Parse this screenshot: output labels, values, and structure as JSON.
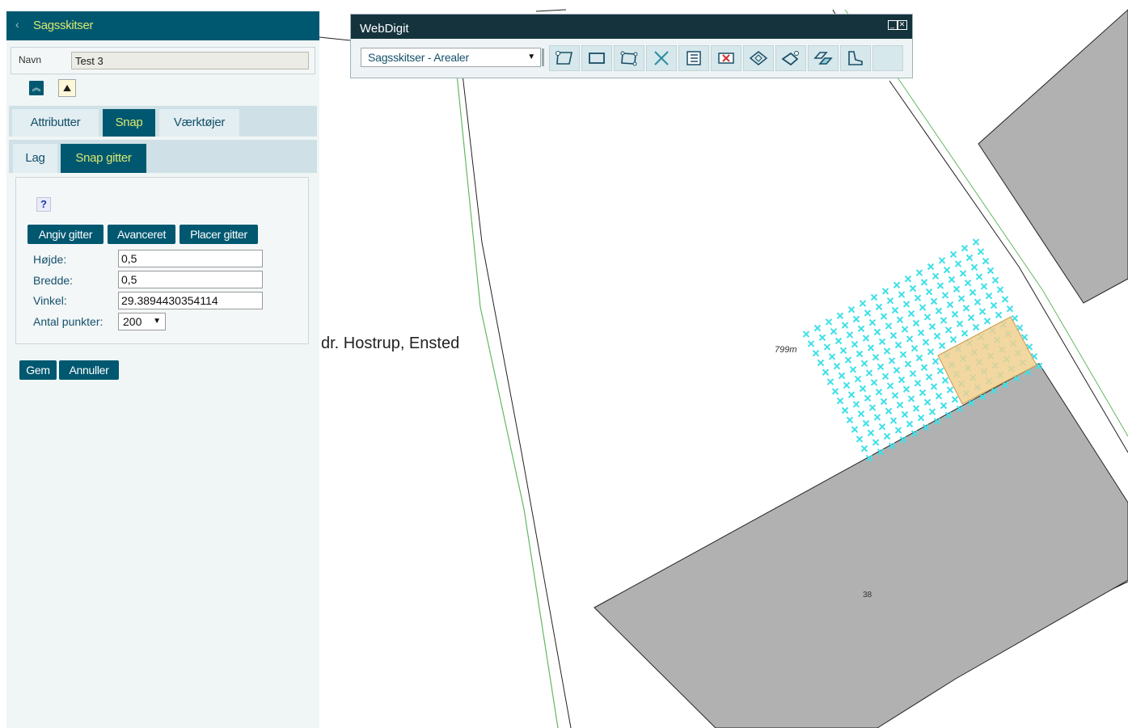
{
  "panel": {
    "title": "Sagsskitser",
    "name_label": "Navn",
    "name_value": "Test 3",
    "tabs": [
      "Attributter",
      "Snap",
      "Værktøjer"
    ],
    "active_tab": "Snap",
    "subtabs": [
      "Lag",
      "Snap gitter"
    ],
    "active_subtab": "Snap gitter",
    "help_glyph": "?",
    "buttons": {
      "angiv": "Angiv gitter",
      "avanceret": "Avanceret",
      "placer": "Placer gitter"
    },
    "fields": {
      "hoejde_label": "Højde:",
      "hoejde_value": "0,5",
      "bredde_label": "Bredde:",
      "bredde_value": "0,5",
      "vinkel_label": "Vinkel:",
      "vinkel_value": "29.3894430354114",
      "antal_label": "Antal punkter:",
      "antal_value": "200"
    },
    "save_label": "Gem",
    "cancel_label": "Annuller",
    "accent_color": "#005870",
    "accent_text_color": "#d9e86f"
  },
  "webdigit": {
    "title": "WebDigit",
    "layer_select": "Sagsskitser - Arealer",
    "tools": [
      "draw-polygon-icon",
      "draw-rectangle-icon",
      "edit-vertices-icon",
      "delete-cross-icon",
      "attribute-list-icon",
      "delete-feature-icon",
      "rotate-icon",
      "move-icon",
      "copy-icon",
      "split-icon"
    ]
  },
  "map": {
    "street_label": "dr. Hostrup, Ensted",
    "parcel_area": "799m",
    "house_number": "38",
    "snap_grid_color": "#3fe0e8",
    "building_fill": "#b1b1b1",
    "sketch_fill": "#f0d090"
  }
}
